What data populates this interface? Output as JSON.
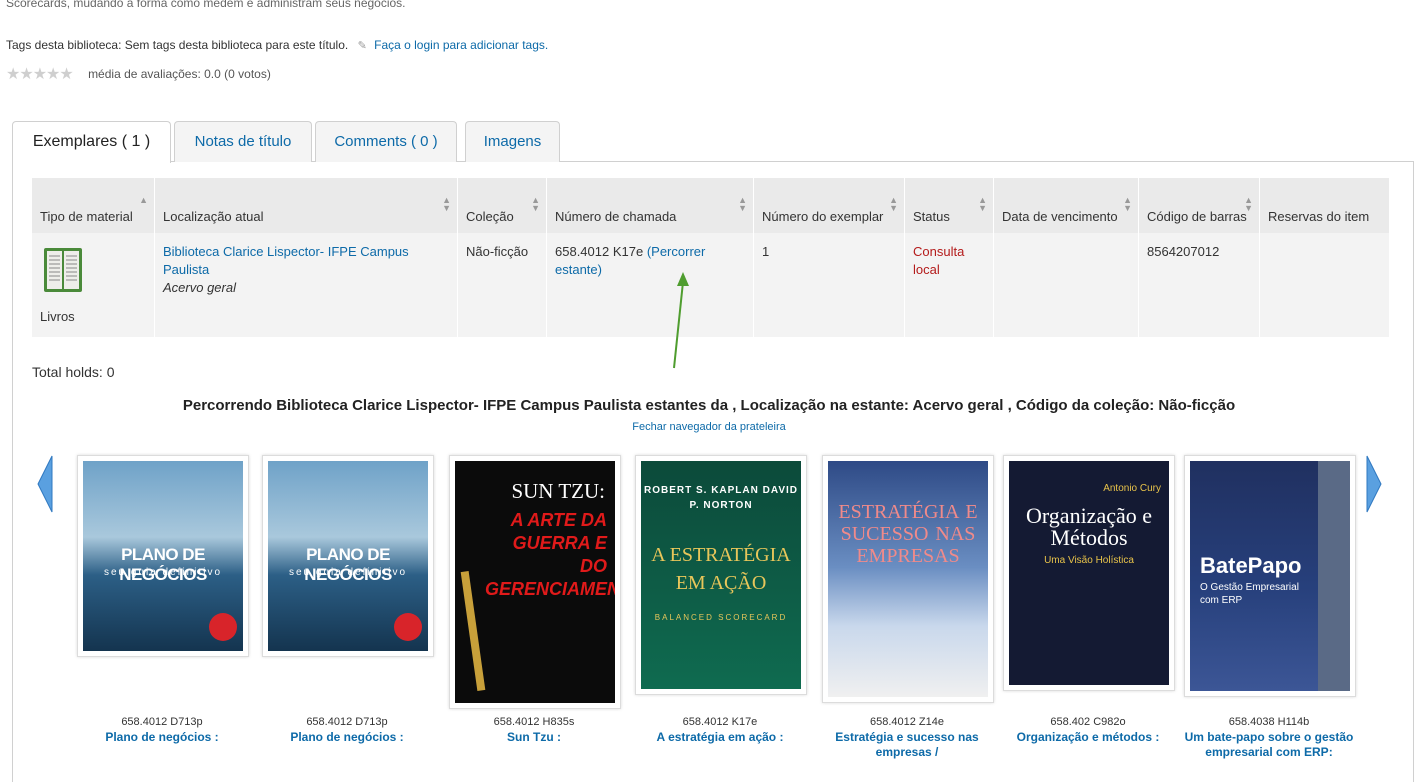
{
  "description_fragment": "Scorecards, mudando a forma como medem e administram seus negócios.",
  "tags": {
    "label": "Tags desta biblioteca:",
    "value": "Sem tags desta biblioteca para este título.",
    "login_link": "Faça o login para adicionar tags."
  },
  "rating": {
    "text": "média de avaliações: 0.0 (0 votos)",
    "stars": 0
  },
  "tabs": [
    {
      "label": "Exemplares ( 1 )"
    },
    {
      "label": "Notas de título"
    },
    {
      "label": "Comments ( 0 )"
    },
    {
      "label": "Imagens"
    }
  ],
  "holdings": {
    "headers": {
      "material_type": "Tipo de material",
      "location": "Localização atual",
      "collection": "Coleção",
      "call_number": "Número de chamada",
      "copy_number": "Número do exemplar",
      "status": "Status",
      "due_date": "Data de vencimento",
      "barcode": "Código de barras",
      "holds": "Reservas do item"
    },
    "row": {
      "material_type": "Livros",
      "location_link": "Biblioteca Clarice Lispector- IFPE Campus Paulista",
      "location_sub": "Acervo geral",
      "collection": "Não-ficção",
      "call_number": "658.4012 K17e",
      "browse_link": "(Percorrer estante)",
      "copy_number": "1",
      "status": "Consulta local",
      "due_date": "",
      "barcode": "8564207012",
      "holds": ""
    }
  },
  "total_holds": "Total holds: 0",
  "shelf_browser": {
    "title": "Percorrendo Biblioteca Clarice Lispector- IFPE Campus Paulista estantes da , Localização na estante: Acervo geral , Código da coleção: Não-ficção",
    "close": "Fechar navegador da prateleira",
    "items": [
      {
        "call": "658.4012 D713p",
        "title": "Plano de negócios :",
        "cover_title": "PLANO DE NEGÓCIOS",
        "cover_sub": "seu guia definitivo"
      },
      {
        "call": "658.4012 D713p",
        "title": "Plano de negócios :",
        "cover_title": "PLANO DE NEGÓCIOS",
        "cover_sub": "seu guia definitivo"
      },
      {
        "call": "658.4012 H835s",
        "title": "Sun Tzu :",
        "cover_title": "SUN TZU:",
        "cover_sub": "A ARTE DA GUERRA E DO GERENCIAMENTO"
      },
      {
        "call": "658.4012 K17e",
        "title": "A estratégia em ação :",
        "cover_title": "A ESTRATÉGIA EM AÇÃO",
        "cover_sub": "BALANCED SCORECARD",
        "cover_authors": "ROBERT S. KAPLAN DAVID P. NORTON"
      },
      {
        "call": "658.4012 Z14e",
        "title": "Estratégia e sucesso nas empresas /",
        "cover_title": "ESTRATÉGIA E SUCESSO NAS EMPRESAS"
      },
      {
        "call": "658.402 C982o",
        "title": "Organização e métodos :",
        "cover_title": "Organização e Métodos",
        "cover_sub": "Uma Visão Holística",
        "cover_author": "Antonio Cury"
      },
      {
        "call": "658.4038 H114b",
        "title": "Um bate-papo sobre o gestão empresarial com ERP:",
        "cover_title": "BatePapo",
        "cover_sub": "O Gestão Empresarial com ERP"
      }
    ]
  },
  "colors": {
    "link": "#0d6aa8",
    "status_local": "#b41b1b",
    "arrow": "#3a8dd6",
    "annotation_arrow": "#4f9d2f"
  }
}
